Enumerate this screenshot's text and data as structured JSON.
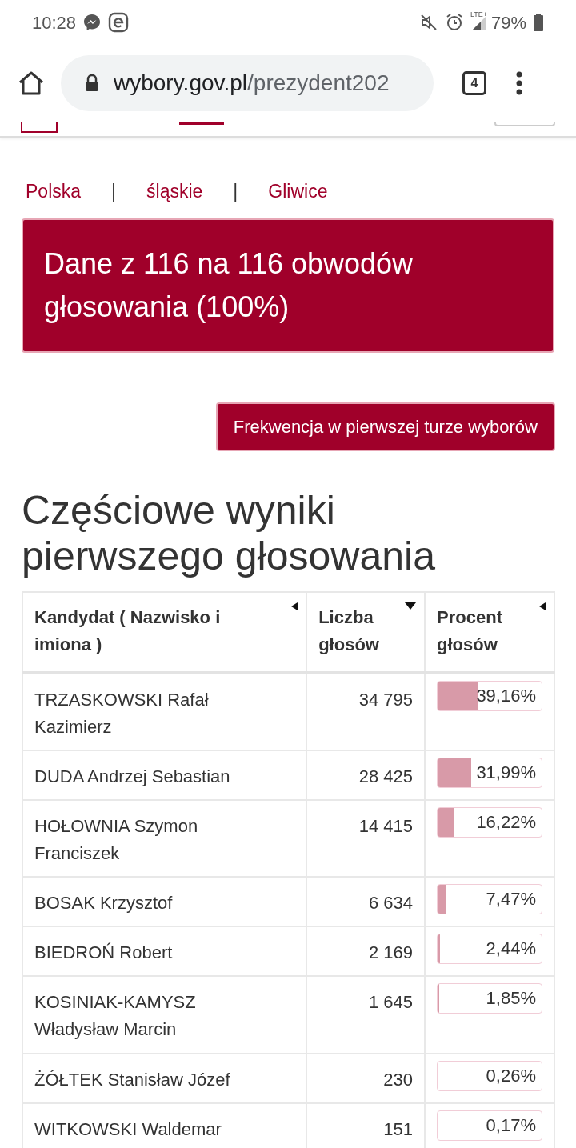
{
  "status_bar": {
    "time": "10:28",
    "battery": "79%",
    "network": "LTE+"
  },
  "address_bar": {
    "host": "wybory.gov.pl",
    "path": "/prezydent202",
    "tab_count": "4"
  },
  "breadcrumb": [
    "Polska",
    "śląskie",
    "Gliwice"
  ],
  "breadcrumb_separators": [
    "|",
    "|"
  ],
  "summary": "Dane z 116 na 116 obwodów głosowania (100%)",
  "turnout_button": "Frekwencja w pierwszej turze wyborów",
  "heading": "Częściowe wyniki pierwszego głosowania",
  "table": {
    "columns": [
      {
        "label": "Kandydat ( Nazwisko i imiona )",
        "sorted": false
      },
      {
        "label": "Liczba głosów",
        "sorted": true
      },
      {
        "label": "Procent głosów",
        "sorted": false
      }
    ],
    "rows": [
      {
        "name": "TRZASKOWSKI Rafał Kazimierz",
        "votes": "34 795",
        "percent": "39,16%",
        "level": 0.3916
      },
      {
        "name": "DUDA Andrzej Sebastian",
        "votes": "28 425",
        "percent": "31,99%",
        "level": 0.3199
      },
      {
        "name": "HOŁOWNIA Szymon Franciszek",
        "votes": "14 415",
        "percent": "16,22%",
        "level": 0.1622
      },
      {
        "name": "BOSAK Krzysztof",
        "votes": "6 634",
        "percent": "7,47%",
        "level": 0.0747
      },
      {
        "name": "BIEDROŃ Robert",
        "votes": "2 169",
        "percent": "2,44%",
        "level": 0.0244
      },
      {
        "name": "KOSINIAK-KAMYSZ Władysław Marcin",
        "votes": "1 645",
        "percent": "1,85%",
        "level": 0.0185
      },
      {
        "name": "ŻÓŁTEK Stanisław Józef",
        "votes": "230",
        "percent": "0,26%",
        "level": 0.0026
      },
      {
        "name": "WITKOWSKI Waldemar",
        "votes": "151",
        "percent": "0,17%",
        "level": 0.0017
      }
    ]
  }
}
